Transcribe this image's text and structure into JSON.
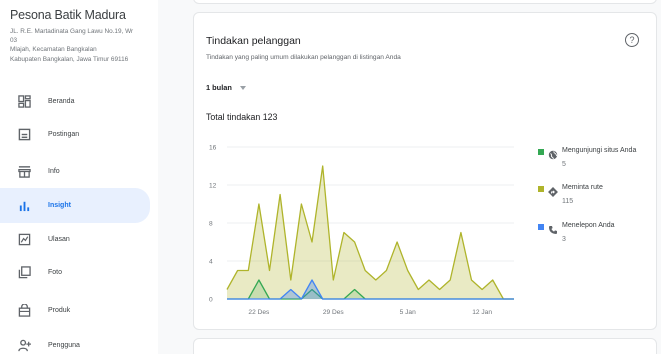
{
  "business": {
    "name": "Pesona Batik Madura",
    "address_lines": [
      "JL. R.E. Martadinata Gang Lawu No.19, Wr",
      "03",
      "Mlajah, Kecamatan Bangkalan",
      "Kabupaten Bangkalan, Jawa Timur 69116"
    ]
  },
  "nav": [
    {
      "label": "Beranda",
      "icon": "home-grid-icon",
      "active": false
    },
    {
      "label": "Postingan",
      "icon": "post-icon",
      "active": false
    },
    {
      "label": "Info",
      "icon": "storefront-icon",
      "active": false
    },
    {
      "label": "Insight",
      "icon": "bar-chart-icon",
      "active": true
    },
    {
      "label": "Ulasan",
      "icon": "reviews-icon",
      "active": false
    },
    {
      "label": "Foto",
      "icon": "photo-icon",
      "active": false
    },
    {
      "label": "Produk",
      "icon": "product-bag-icon",
      "active": false
    },
    {
      "label": "Pengguna",
      "icon": "add-user-icon",
      "active": false
    }
  ],
  "card": {
    "title": "Tindakan pelanggan",
    "subtitle": "Tindakan yang paling umum dilakukan pelanggan di listingan Anda",
    "period": "1 bulan",
    "total": "Total tindakan 123",
    "help_icon": "help-circle-icon"
  },
  "colors": {
    "accent": "#1a73e8",
    "active_bg": "#e8f0fe",
    "series_website": "#34a853",
    "series_route": "#afb42b",
    "series_call": "#4285f4"
  },
  "chart_data": {
    "type": "area",
    "x_ticks": [
      "22 Des",
      "29 Des",
      "5 Jan",
      "12 Jan"
    ],
    "x_tick_index": [
      3,
      10,
      17,
      24
    ],
    "ylim": [
      0,
      16
    ],
    "y_ticks": [
      0,
      4,
      8,
      12,
      16
    ],
    "grid": true,
    "legend": "right",
    "series": [
      {
        "name": "Mengunjungi situs Anda",
        "total": "5",
        "color": "#34a853",
        "icon": "globe-icon",
        "values": [
          0,
          0,
          0,
          2,
          0,
          0,
          0,
          0,
          1,
          0,
          0,
          0,
          1,
          0,
          0,
          0,
          0,
          0,
          0,
          0,
          0,
          0,
          0,
          0,
          0,
          0,
          0,
          0
        ]
      },
      {
        "name": "Meminta rute",
        "total": "115",
        "color": "#afb42b",
        "icon": "directions-icon",
        "values": [
          1,
          3,
          3,
          10,
          3,
          11,
          2,
          10,
          6,
          14,
          2,
          7,
          6,
          3,
          2,
          3,
          6,
          3,
          1,
          2,
          1,
          2,
          7,
          2,
          1,
          2,
          0,
          0
        ]
      },
      {
        "name": "Menelepon Anda",
        "total": "3",
        "color": "#4285f4",
        "icon": "phone-icon",
        "values": [
          0,
          0,
          0,
          0,
          0,
          0,
          1,
          0,
          2,
          0,
          0,
          0,
          0,
          0,
          0,
          0,
          0,
          0,
          0,
          0,
          0,
          0,
          0,
          0,
          0,
          0,
          0,
          0
        ]
      }
    ]
  }
}
